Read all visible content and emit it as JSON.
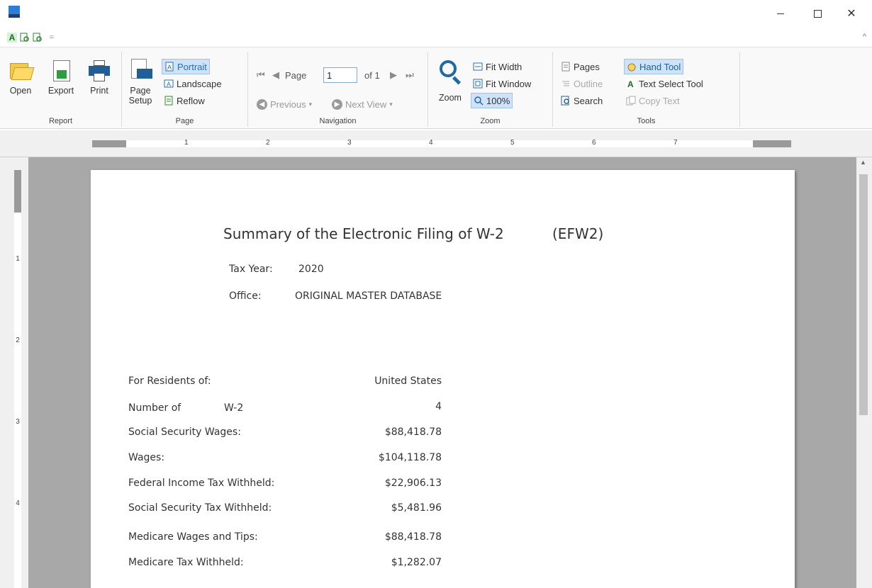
{
  "window": {
    "minimize_label": "–",
    "close_label": "✕"
  },
  "quick_access": {
    "a_label": "A",
    "dropdown_label": "="
  },
  "ribbon": {
    "collapse_label": "^",
    "report": {
      "group_label": "Report",
      "open_label": "Open",
      "export_label": "Export",
      "print_label": "Print"
    },
    "page": {
      "group_label": "Page",
      "page_setup_line1": "Page",
      "page_setup_line2": "Setup",
      "portrait_label": "Portrait",
      "landscape_label": "Landscape",
      "reflow_label": "Reflow"
    },
    "navigation": {
      "group_label": "Navigation",
      "page_label": "Page",
      "page_value": "1",
      "of_label": "of 1",
      "previous_label": "Previous",
      "next_view_label": "Next View"
    },
    "zoom": {
      "group_label": "Zoom",
      "zoom_label": "Zoom",
      "fit_width_label": "Fit Width",
      "fit_window_label": "Fit Window",
      "zoom_100_label": "100%"
    },
    "tools": {
      "group_label": "Tools",
      "pages_label": "Pages",
      "outline_label": "Outline",
      "search_label": "Search",
      "hand_tool_label": "Hand Tool",
      "text_select_label": "Text Select Tool",
      "copy_text_label": "Copy Text"
    }
  },
  "ruler": {
    "h_numbers": [
      "1",
      "2",
      "3",
      "4",
      "5",
      "6",
      "7"
    ],
    "v_numbers": [
      "1",
      "2",
      "3",
      "4"
    ]
  },
  "report": {
    "title": "Summary of the Electronic Filing of W-2",
    "title_code": "(EFW2)",
    "tax_year_label": "Tax Year:",
    "tax_year_value": "2020",
    "office_label": "Office:",
    "office_value": "ORIGINAL MASTER DATABASE",
    "rows": [
      {
        "label": "For Residents of:",
        "value": "United States"
      },
      {
        "label": "Number of",
        "label2": "W-2",
        "value": "4"
      },
      {
        "label": "Social Security Wages:",
        "value": "$88,418.78"
      },
      {
        "label": "Wages:",
        "value": "$104,118.78"
      },
      {
        "label": "Federal Income Tax Withheld:",
        "value": "$22,906.13"
      },
      {
        "label": "Social Security Tax Withheld:",
        "value": "$5,481.96"
      },
      {
        "label": "Medicare Wages and Tips:",
        "value": "$88,418.78"
      },
      {
        "label": "Medicare Tax Withheld:",
        "value": "$1,282.07"
      }
    ]
  },
  "colors": {
    "accent_blue": "#1f5f96",
    "selected_bg": "#cfe2fa",
    "workspace_bg": "#a8a8a8"
  }
}
